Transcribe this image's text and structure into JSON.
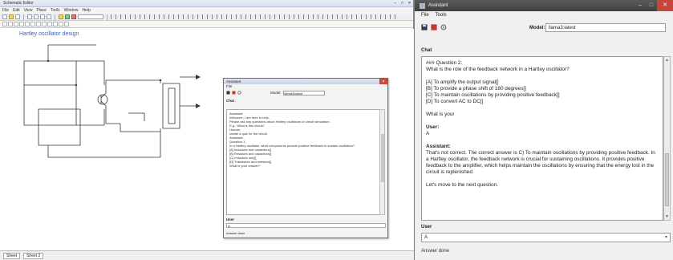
{
  "editor": {
    "title": "Schematic Editor",
    "menu": [
      "File",
      "Edit",
      "View",
      "Place",
      "Tools",
      "Window",
      "Help"
    ],
    "sheet_title": "Hartley oscillator design",
    "status_tabs": [
      "Sheet",
      "Sheet 2"
    ]
  },
  "mini_chat": {
    "title": "Assistant",
    "menu_file": "File",
    "model_label": "Model:",
    "model_value": "llama3:latest",
    "chat_label": "Chat",
    "messages": [
      "Assistant:\nWelcome, I am here to help.\nPlease ask any questions about Hartley oscillators or circuit simulation.\nE.g.: What is this circuit?",
      "Human:\ncreate a quiz for the circuit",
      "Assistant:\nQuestion 1:\nIn a Hartley oscillator, what components provide positive feedback to sustain oscillation?",
      "[A] Inductors and capacitors[]\n[B] Resistors and capacitors[]\n[C] Inductors only[]\n[D] Transistors and resistors[]",
      "What is your answer?"
    ],
    "user_label": "User",
    "input_value": "A",
    "status": "Answer done"
  },
  "assistant": {
    "title": "Assistant",
    "window_controls": [
      "–",
      "□",
      "✕"
    ],
    "menu": [
      "File",
      "Tools"
    ],
    "model_label": "Model:",
    "model_value": "llama3:latest",
    "chat_label": "Chat",
    "question_header": "### Question 2:",
    "question_text": "What is the role of the feedback network in a Hartley oscillator?",
    "options": [
      "[A] To amplify the output signal[]",
      "[B] To provide a phase shift of 180 degrees[]",
      "[C] To maintain oscillations by providing positive feedback[]",
      "[D] To convert AC to DC[]"
    ],
    "prompt_line": "What is your",
    "user_speaker": "User:",
    "user_answer": "A",
    "assistant_speaker": "Assistant:",
    "assistant_reply": "That's not correct. The correct answer is C) To maintain oscillations by providing positive feedback. In a Hartley oscillator, the feedback network is crucial for sustaining oscillations. It provides positive feedback to the amplifier, which helps maintain the oscillations by ensuring that the energy lost in the circuit is replenished.",
    "next_line": "Let's move to the next question.",
    "user_label": "User",
    "input_value": "A",
    "status": "Answer done"
  }
}
